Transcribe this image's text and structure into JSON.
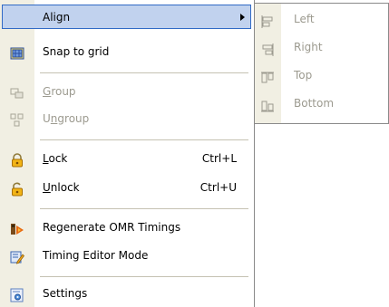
{
  "menu": {
    "items": [
      {
        "label": "Align",
        "icon": "align-icon",
        "submenu": true,
        "highlighted": true
      },
      {
        "label": "Snap to grid",
        "icon": "grid-icon"
      },
      {
        "label": "Group",
        "icon": "group-icon",
        "disabled": true,
        "mnemonic": "G"
      },
      {
        "label": "Ungroup",
        "icon": "ungroup-icon",
        "disabled": true,
        "mnemonic": "n"
      },
      {
        "label": "Lock",
        "icon": "lock-icon",
        "shortcut": "Ctrl+L",
        "mnemonic": "L"
      },
      {
        "label": "Unlock",
        "icon": "unlock-icon",
        "shortcut": "Ctrl+U",
        "mnemonic": "U"
      },
      {
        "label": "Regenerate OMR Timings",
        "icon": "regenerate-icon"
      },
      {
        "label": "Timing Editor Mode",
        "icon": "timing-editor-icon"
      },
      {
        "label": "Settings",
        "icon": "settings-icon"
      }
    ]
  },
  "align_submenu": {
    "items": [
      {
        "label": "Left",
        "icon": "align-left-icon",
        "disabled": true
      },
      {
        "label": "Right",
        "icon": "align-right-icon",
        "disabled": true
      },
      {
        "label": "Top",
        "icon": "align-top-icon",
        "disabled": true
      },
      {
        "label": "Bottom",
        "icon": "align-bottom-icon",
        "disabled": true
      }
    ]
  },
  "colors": {
    "highlight_fill": "#c1d2ee",
    "highlight_border": "#316ac5",
    "icon_strip": "#f1efe3",
    "disabled_text": "#9c9a8f"
  }
}
